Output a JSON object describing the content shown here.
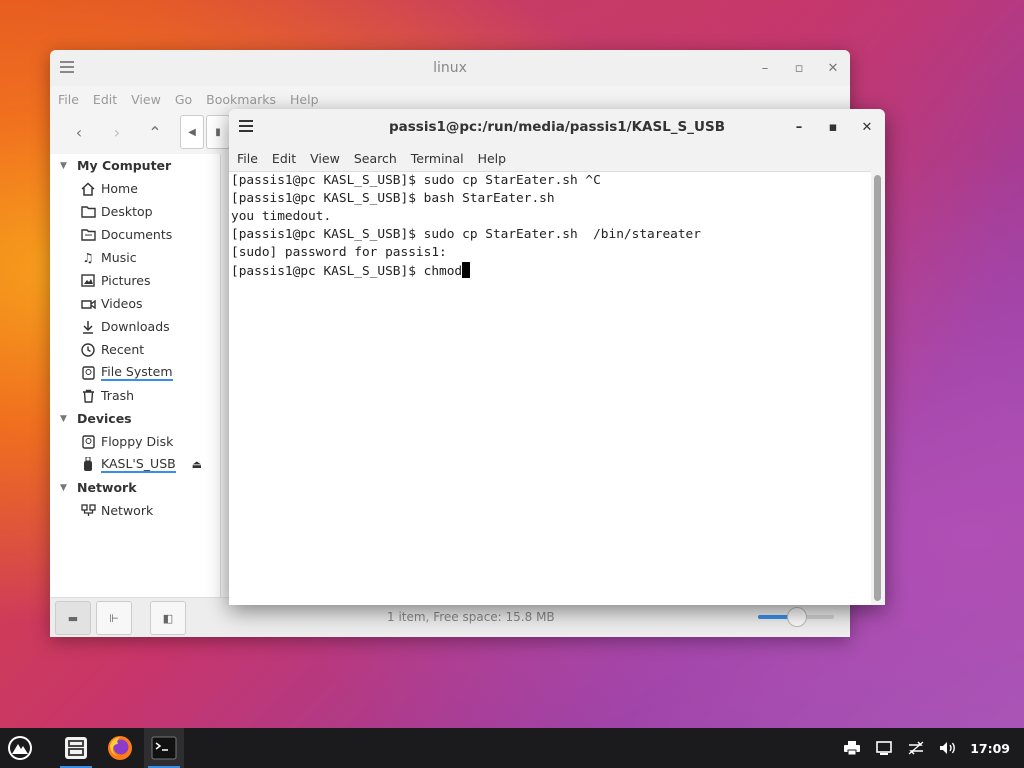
{
  "file_manager": {
    "title": "linux",
    "menu": [
      "File",
      "Edit",
      "View",
      "Go",
      "Bookmarks",
      "Help"
    ],
    "sidebar": {
      "sections": [
        {
          "label": "My Computer",
          "items": [
            "Home",
            "Desktop",
            "Documents",
            "Music",
            "Pictures",
            "Videos",
            "Downloads",
            "Recent",
            "File System",
            "Trash"
          ]
        },
        {
          "label": "Devices",
          "items": [
            "Floppy Disk",
            "KASL'S_USB"
          ]
        },
        {
          "label": "Network",
          "items": [
            "Network"
          ]
        }
      ]
    },
    "status_text": "1 item, Free space: 15.8 MB",
    "zoom_level": 0.5
  },
  "terminal": {
    "title": "passis1@pc:/run/media/passis1/KASL_S_USB",
    "menu": [
      "File",
      "Edit",
      "View",
      "Search",
      "Terminal",
      "Help"
    ],
    "lines": [
      "[passis1@pc KASL_S_USB]$ sudo cp StarEater.sh ^C",
      "[passis1@pc KASL_S_USB]$ bash StarEater.sh",
      "you timedout.",
      "[passis1@pc KASL_S_USB]$ sudo cp StarEater.sh  /bin/stareater",
      "[sudo] password for passis1:",
      "[passis1@pc KASL_S_USB]$ chmod"
    ]
  },
  "taskbar": {
    "apps": [
      "menu-icon",
      "file-manager-icon",
      "firefox-icon",
      "terminal-icon"
    ],
    "clock": "17:09",
    "tray": [
      "printer-icon",
      "display-icon",
      "network-icon",
      "volume-icon"
    ]
  },
  "colors": {
    "accent": "#3b8ee8",
    "taskbar": "#1b1b1d"
  }
}
